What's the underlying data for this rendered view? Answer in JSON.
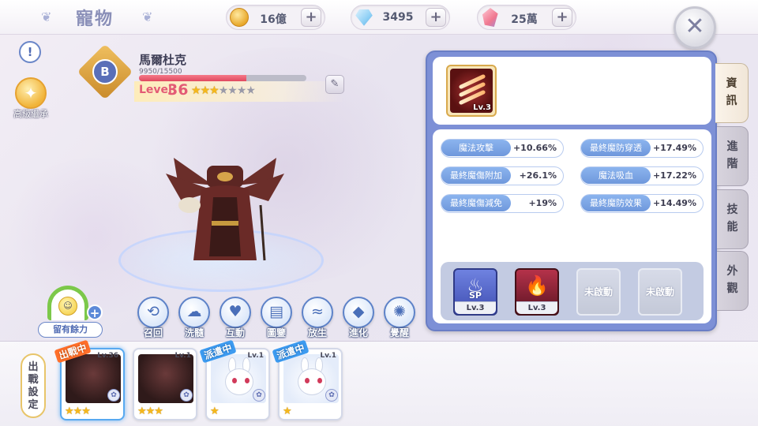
{
  "header": {
    "title": "寵物",
    "currencies": [
      {
        "icon": "gold-coin-icon",
        "value": "16億"
      },
      {
        "icon": "diamond-icon",
        "value": "3495"
      },
      {
        "icon": "crystal-icon",
        "value": "25萬"
      }
    ],
    "plus_label": "+",
    "close_label": "✕"
  },
  "left": {
    "info_label": "!",
    "legacy_label": "高級繼承",
    "rank": "B",
    "pet_name": "馬爾杜克",
    "hp_text": "9950/15500",
    "hp_fraction": 0.642,
    "level_label": "Level",
    "level_value": "36",
    "stars_filled": 3,
    "stars_total": 7,
    "stamina_label": "留有餘力"
  },
  "actions": [
    {
      "label": "召回",
      "icon": "recall-icon"
    },
    {
      "label": "洗髓",
      "icon": "cleanse-icon"
    },
    {
      "label": "互動",
      "icon": "heart-icon"
    },
    {
      "label": "圖鑒",
      "icon": "book-icon"
    },
    {
      "label": "放生",
      "icon": "release-icon"
    },
    {
      "label": "進化",
      "icon": "evolve-icon"
    },
    {
      "label": "覺醒",
      "icon": "awaken-icon"
    }
  ],
  "panel": {
    "card_level": "Lv.3",
    "stats": [
      {
        "name": "魔法攻擊",
        "value": "+10.66%"
      },
      {
        "name": "最終魔防穿透",
        "value": "+17.49%"
      },
      {
        "name": "最終魔傷附加",
        "value": "+26.1%"
      },
      {
        "name": "魔法吸血",
        "value": "+17.22%"
      },
      {
        "name": "最終魔傷減免",
        "value": "+19%"
      },
      {
        "name": "最終魔防效果",
        "value": "+14.49%"
      }
    ],
    "skills": [
      {
        "type": "sp",
        "badge": "SP",
        "level": "Lv.3"
      },
      {
        "type": "fire",
        "level": "Lv.3"
      },
      {
        "type": "locked",
        "label": "未啟動"
      },
      {
        "type": "locked",
        "label": "未啟動"
      }
    ]
  },
  "tabs": [
    "資訊",
    "進階",
    "技能",
    "外觀"
  ],
  "bottom": {
    "deploy_label": "出戰設定",
    "slots": [
      {
        "tag": "出戰中",
        "level": "Lv.36",
        "stars": 3,
        "kind": "dark"
      },
      {
        "tag": "",
        "level": "Lv.1",
        "stars": 3,
        "kind": "dark"
      },
      {
        "tag": "派遣中",
        "level": "Lv.1",
        "stars": 1,
        "kind": "bunny"
      },
      {
        "tag": "派遣中",
        "level": "Lv.1",
        "stars": 1,
        "kind": "bunny"
      }
    ]
  },
  "colors": {
    "accent": "#6a86c8",
    "panel": "#7d90d6",
    "level": "#e35b75",
    "star": "#f5b81c"
  }
}
